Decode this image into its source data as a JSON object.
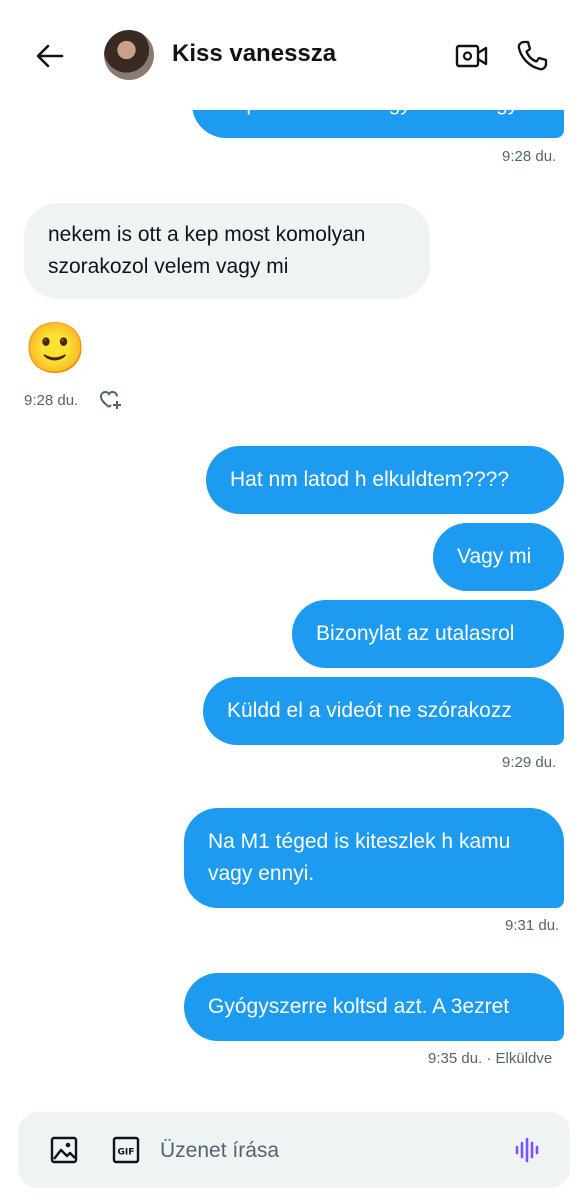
{
  "header": {
    "title": "Kiss vanessza"
  },
  "messages": {
    "m1": "Es persze h te is egy kamu vagy",
    "t1": "9:28 du.",
    "m2_line1": "nekem is ott a kep most komolyan",
    "m2_line2": "szorakozol velem vagy mi",
    "emoji": "🙂",
    "t2": "9:28 du.",
    "m3": "Hat nm latod h elkuldtem????",
    "m4": "Vagy mi",
    "m5": "Bizonylat az utalasrol",
    "m6": "Küldd el a videót ne szórakozz",
    "t3": "9:29 du.",
    "m7_line1": "Na M1 téged is kiteszlek h kamu",
    "m7_line2": "vagy ennyi.",
    "t4": "9:31 du.",
    "m8": "Gyógyszerre koltsd azt. A 3ezret",
    "t5": "9:35 du. · Elküldve"
  },
  "composer": {
    "placeholder": "Üzenet írása"
  },
  "colors": {
    "accent": "#1d9bf0",
    "incoming": "#eff3f4",
    "muted": "#536471",
    "voice": "#7856ff"
  }
}
